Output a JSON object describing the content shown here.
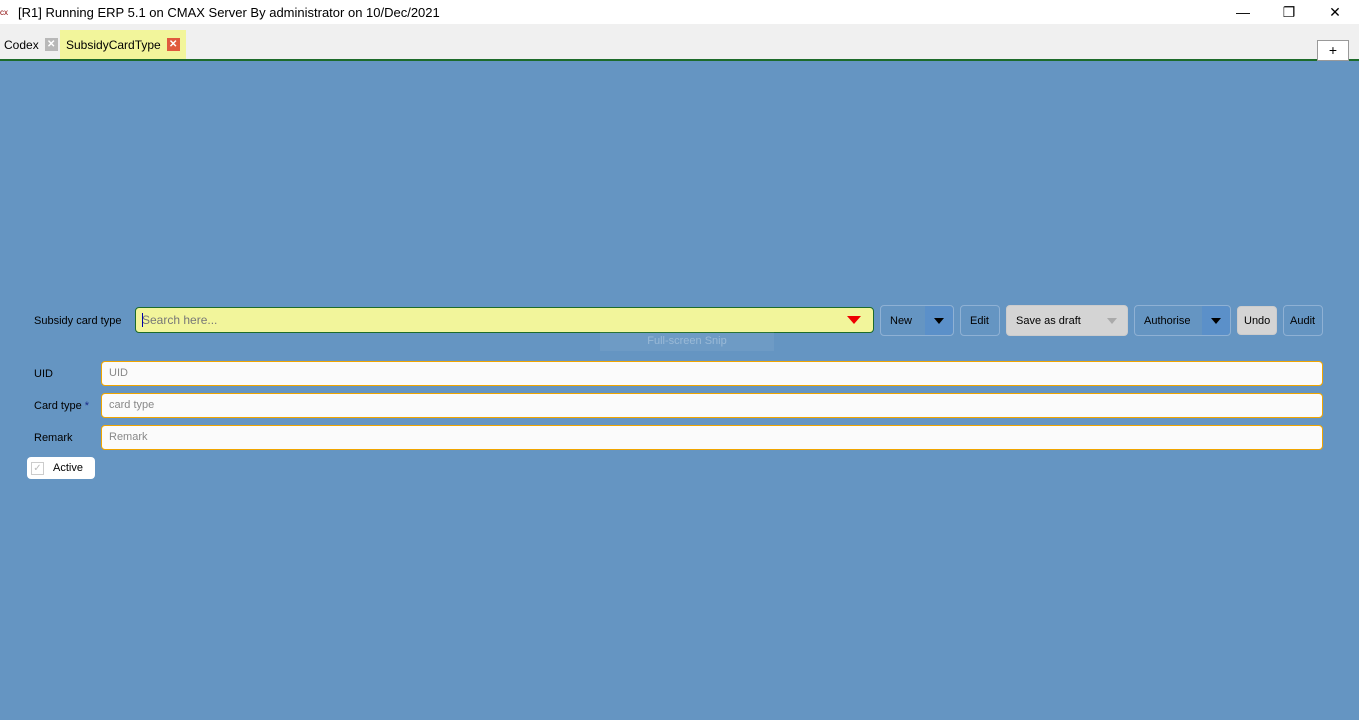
{
  "window": {
    "title": "[R1] Running ERP 5.1 on CMAX Server By administrator on 10/Dec/2021",
    "app_icon": "cx",
    "minimize": "—",
    "restore": "❐",
    "close": "✕"
  },
  "tabs": [
    {
      "label": "Codex",
      "close": "✕"
    },
    {
      "label": "SubsidyCardType",
      "close": "✕",
      "active": true
    }
  ],
  "add_tab": "+",
  "search": {
    "label": "Subsidy card type",
    "placeholder": "Search here..."
  },
  "toolbar": {
    "new": "New",
    "edit": "Edit",
    "save_draft": "Save as draft",
    "authorise": "Authorise",
    "undo": "Undo",
    "audit": "Audit"
  },
  "overlay": "Full-screen Snip",
  "form": {
    "uid": {
      "label": "UID",
      "placeholder": "UID"
    },
    "card_type": {
      "label": "Card type",
      "required": "*",
      "placeholder": "card type"
    },
    "remark": {
      "label": "Remark",
      "placeholder": "Remark"
    },
    "active": {
      "label": "Active",
      "checked": true
    }
  },
  "colors": {
    "background": "#6595c2",
    "active_tab": "#f2f59b",
    "field_border": "#f0a500"
  }
}
